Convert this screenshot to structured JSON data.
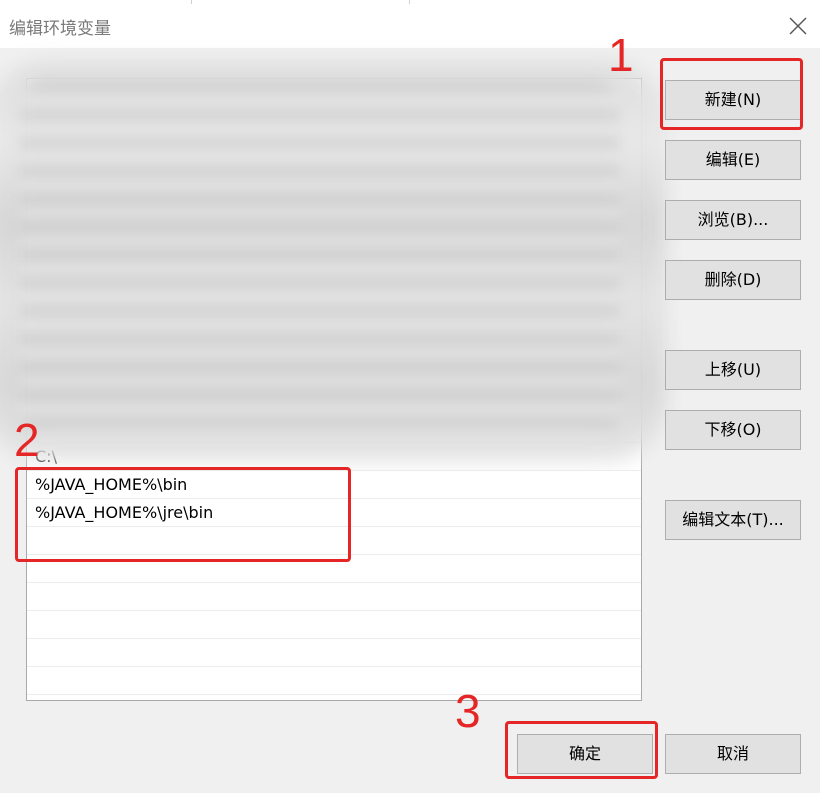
{
  "window": {
    "title": "编辑环境变量"
  },
  "paths": [
    {
      "row": 14,
      "value": "C:\\"
    },
    {
      "row": 15,
      "value": "%JAVA_HOME%\\bin"
    },
    {
      "row": 16,
      "value": "%JAVA_HOME%\\jre\\bin"
    }
  ],
  "side_buttons": {
    "new": "新建(N)",
    "edit": "编辑(E)",
    "browse": "浏览(B)...",
    "delete": "删除(D)",
    "move_up": "上移(U)",
    "move_down": "下移(O)",
    "edit_text": "编辑文本(T)..."
  },
  "footer_buttons": {
    "ok": "确定",
    "cancel": "取消"
  },
  "annotations": {
    "step1": "1",
    "step2": "2",
    "step3": "3"
  },
  "colors": {
    "annotation": "#e52626",
    "button_face": "#e1e1e1",
    "dialog_bg": "#f0f0f0"
  }
}
